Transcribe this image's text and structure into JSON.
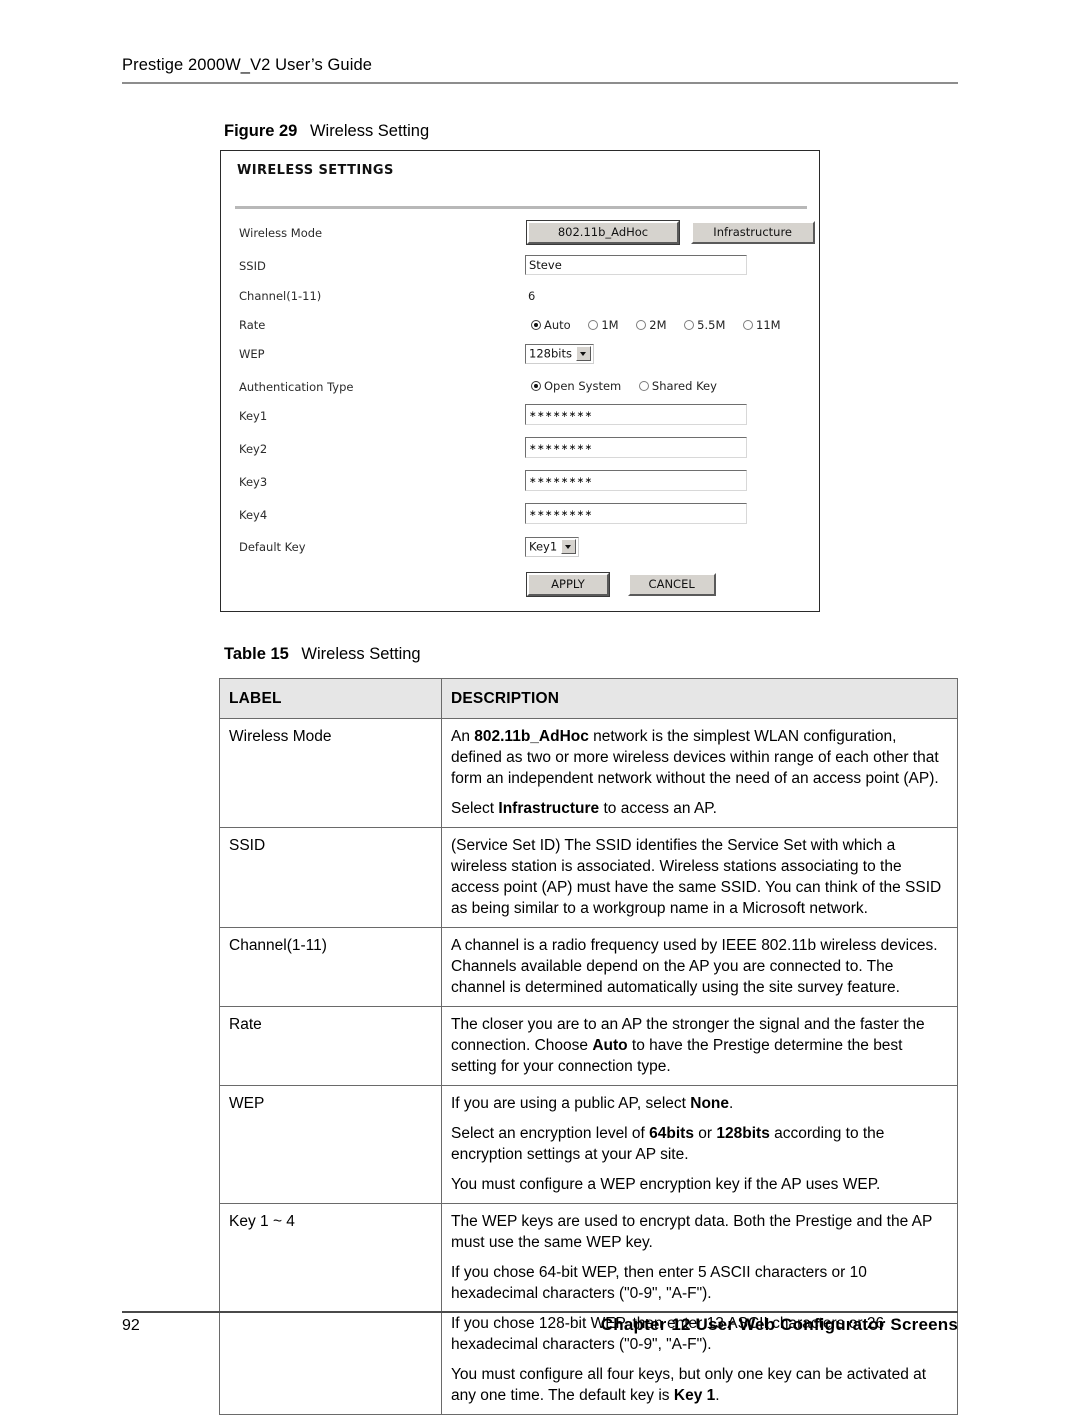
{
  "page": {
    "running_head": "Prestige 2000W_V2 User’s Guide",
    "footer_page_number": "92",
    "footer_chapter": "Chapter 12 User Web Configurator Screens"
  },
  "figure": {
    "caption_number": "Figure 29",
    "caption_text": "Wireless Setting"
  },
  "screenshot": {
    "title": "WIRELESS SETTINGS",
    "rows": {
      "wireless_mode": {
        "label": "Wireless Mode",
        "button_adhoc": "802.11b_AdHoc",
        "button_infrastructure": "Infrastructure"
      },
      "ssid": {
        "label": "SSID",
        "value": "Steve"
      },
      "channel": {
        "label": "Channel(1-11)",
        "value": "6"
      },
      "rate": {
        "label": "Rate",
        "options": [
          "Auto",
          "1M",
          "2M",
          "5.5M",
          "11M"
        ],
        "selected": "Auto"
      },
      "wep": {
        "label": "WEP",
        "value": "128bits"
      },
      "auth_type": {
        "label": "Authentication Type",
        "options": [
          "Open System",
          "Shared Key"
        ],
        "selected": "Open System"
      },
      "key1": {
        "label": "Key1",
        "value": "∗∗∗∗∗∗∗∗"
      },
      "key2": {
        "label": "Key2",
        "value": "∗∗∗∗∗∗∗∗"
      },
      "key3": {
        "label": "Key3",
        "value": "∗∗∗∗∗∗∗∗"
      },
      "key4": {
        "label": "Key4",
        "value": "∗∗∗∗∗∗∗∗"
      },
      "default_key": {
        "label": "Default Key",
        "value": "Key1"
      }
    },
    "actions": {
      "apply": "APPLY",
      "cancel": "CANCEL"
    }
  },
  "table": {
    "caption_number": "Table 15",
    "caption_text": "Wireless Setting",
    "headers": {
      "label": "LABEL",
      "description": "DESCRIPTION"
    },
    "rows": {
      "wireless_mode": {
        "label": "Wireless Mode",
        "p1_a": "An ",
        "p1_b": "802.11b_AdHoc",
        "p1_c": " network is the simplest WLAN configuration, defined as two or more wireless devices within range of each other that form an independent network without the need of an access point (AP).",
        "p2_a": "Select ",
        "p2_b": "Infrastructure",
        "p2_c": " to access an AP."
      },
      "ssid": {
        "label": "SSID",
        "p1": "(Service Set ID) The SSID identifies the Service Set with which a wireless station is associated. Wireless stations associating to the access point (AP) must have the same SSID. You can think of the SSID as being similar to a workgroup name in a Microsoft network."
      },
      "channel": {
        "label": "Channel(1-11)",
        "p1": "A channel is a radio frequency used by IEEE 802.11b wireless devices. Channels available depend on the AP you are connected to. The channel is determined automatically using the site survey feature."
      },
      "rate": {
        "label": "Rate",
        "p1_a": "The closer you are to an AP the stronger the signal and the faster the connection. Choose ",
        "p1_b": "Auto",
        "p1_c": " to have the Prestige determine the best setting for your connection type."
      },
      "wep": {
        "label": "WEP",
        "p1_a": "If you are using a public AP, select ",
        "p1_b": "None",
        "p1_c": ".",
        "p2_a": "Select an encryption level of ",
        "p2_b": "64bits",
        "p2_c": " or ",
        "p2_d": "128bits",
        "p2_e": " according to the encryption settings at your AP site.",
        "p3": "You must configure a WEP encryption key if the AP uses WEP."
      },
      "keys": {
        "label": "Key 1 ~ 4",
        "p1": "The WEP keys are used to encrypt data. Both the Prestige and the AP must use the same WEP key.",
        "p2": "If you chose 64-bit WEP, then enter 5 ASCII characters or 10 hexadecimal characters (\"0-9\", \"A-F\").",
        "p3": "If you chose 128-bit WEP, then enter 13 ASCII characters or 26 hexadecimal characters (\"0-9\", \"A-F\").",
        "p4_a": "You must configure all four keys, but only one key can be activated at any one time. The default key is ",
        "p4_b": "Key 1",
        "p4_c": "."
      }
    }
  }
}
